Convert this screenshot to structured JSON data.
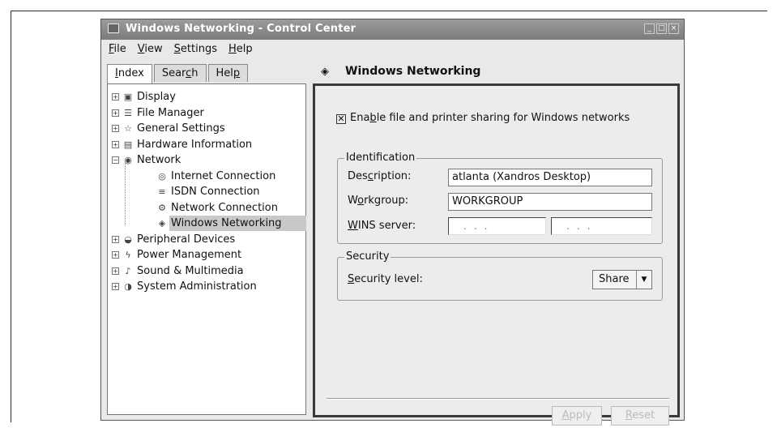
{
  "window": {
    "title": "Windows Networking - Control Center",
    "controls": [
      "_",
      "□",
      "×"
    ]
  },
  "menu": [
    {
      "pre": "",
      "u": "F",
      "post": "ile"
    },
    {
      "pre": "",
      "u": "V",
      "post": "iew"
    },
    {
      "pre": "",
      "u": "S",
      "post": "ettings"
    },
    {
      "pre": "",
      "u": "H",
      "post": "elp"
    }
  ],
  "tabs": [
    {
      "pre": "",
      "u": "I",
      "post": "ndex",
      "active": true
    },
    {
      "pre": "Sear",
      "u": "c",
      "post": "h",
      "active": false
    },
    {
      "pre": "Hel",
      "u": "p",
      "post": "",
      "active": false
    }
  ],
  "tree": [
    {
      "label": "Display",
      "expander": "+",
      "icon": "display-icon",
      "glyph": "▣",
      "level": 0
    },
    {
      "label": "File Manager",
      "expander": "+",
      "icon": "file-manager-icon",
      "glyph": "☰",
      "level": 0
    },
    {
      "label": "General Settings",
      "expander": "+",
      "icon": "star-icon",
      "glyph": "☆",
      "level": 0
    },
    {
      "label": "Hardware Information",
      "expander": "+",
      "icon": "hardware-icon",
      "glyph": "▤",
      "level": 0
    },
    {
      "label": "Network",
      "expander": "−",
      "icon": "network-icon",
      "glyph": "◉",
      "level": 0
    },
    {
      "label": "Internet Connection",
      "expander": "",
      "icon": "internet-icon",
      "glyph": "◎",
      "level": 1
    },
    {
      "label": "ISDN Connection",
      "expander": "",
      "icon": "isdn-icon",
      "glyph": "≡",
      "level": 1
    },
    {
      "label": "Network Connection",
      "expander": "",
      "icon": "network-connection-icon",
      "glyph": "⚙",
      "level": 1
    },
    {
      "label": "Windows Networking",
      "expander": "",
      "icon": "windows-networking-icon",
      "glyph": "◈",
      "level": 1,
      "selected": true
    },
    {
      "label": "Peripheral Devices",
      "expander": "+",
      "icon": "peripheral-icon",
      "glyph": "◒",
      "level": 0
    },
    {
      "label": "Power Management",
      "expander": "+",
      "icon": "power-icon",
      "glyph": "ϟ",
      "level": 0
    },
    {
      "label": "Sound & Multimedia",
      "expander": "+",
      "icon": "sound-icon",
      "glyph": "♪",
      "level": 0
    },
    {
      "label": "System Administration",
      "expander": "+",
      "icon": "system-admin-icon",
      "glyph": "◑",
      "level": 0
    }
  ],
  "page": {
    "title": "Windows Networking",
    "sharing": {
      "pre": "Ena",
      "u": "b",
      "post": "le file and printer sharing for Windows networks",
      "checked": "✕"
    },
    "identification": {
      "legend": "Identification",
      "description_label": {
        "pre": "Des",
        "u": "c",
        "post": "ription:"
      },
      "description_value": "atlanta (Xandros Desktop)",
      "workgroup_label": {
        "pre": "W",
        "u": "o",
        "post": "rkgroup:"
      },
      "workgroup_value": "WORKGROUP",
      "wins_label": {
        "pre": "",
        "u": "W",
        "post": "INS server:"
      },
      "wins_ip_1": "...",
      "wins_ip_2": "..."
    },
    "security": {
      "legend": "Security",
      "level_label": {
        "pre": "",
        "u": "S",
        "post": "ecurity level:"
      },
      "level_value": "Share"
    },
    "apply": {
      "pre": "",
      "u": "A",
      "post": "pply"
    },
    "reset": {
      "pre": "",
      "u": "R",
      "post": "eset"
    }
  }
}
